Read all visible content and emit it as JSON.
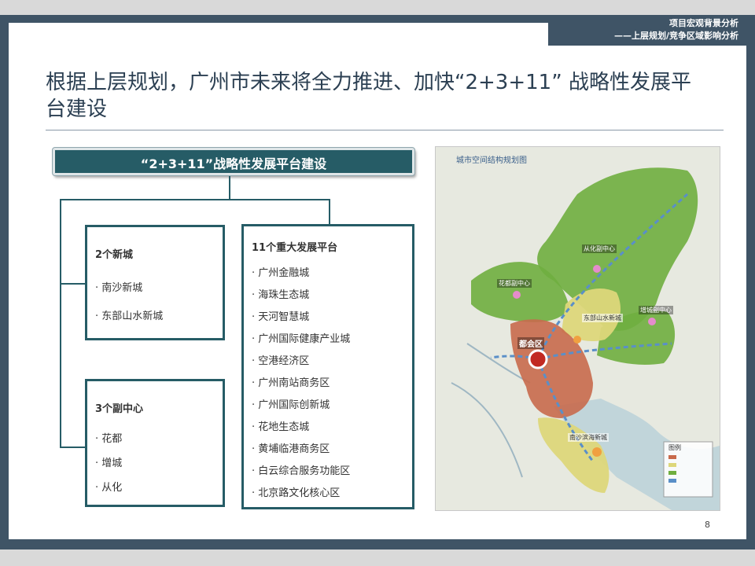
{
  "header": {
    "line1": "项目宏观背景分析",
    "line2": "——上层规划/竞争区域影响分析"
  },
  "title": "根据上层规划，广州市未来将全力推进、加快“2+3+11” 战略性发展平台建设",
  "banner": "“2+3+11”战略性发展平台建设",
  "box_new_cities": {
    "title": "2个新城",
    "items": [
      "· 南沙新城",
      "· 东部山水新城"
    ]
  },
  "box_sub_centers": {
    "title": "3个副中心",
    "items": [
      "· 花都",
      "· 增城",
      "· 从化"
    ]
  },
  "box_platforms": {
    "title": "11个重大发展平台",
    "items": [
      "· 广州金融城",
      "· 海珠生态城",
      "· 天河智慧城",
      "· 广州国际健康产业城",
      "· 空港经济区",
      "· 广州南站商务区",
      "· 广州国际创新城",
      "· 花地生态城",
      "· 黄埔临港商务区",
      "· 白云综合服务功能区",
      "· 北京路文化核心区"
    ]
  },
  "map": {
    "title": "城市空间结构规划图",
    "labels": {
      "conghua": "从化副中心",
      "huadu": "花都副中心",
      "zengcheng": "增城副中心",
      "dongbu": "东部山水新城",
      "duhui": "都会区",
      "nansha": "南沙滨海新城",
      "legend": "图例"
    },
    "colors": {
      "green": "#6fae3f",
      "yellow": "#ddd77a",
      "red": "#c86a4c",
      "water": "#b8cfd8",
      "base": "#e7e9e0"
    }
  },
  "page_number": "8"
}
